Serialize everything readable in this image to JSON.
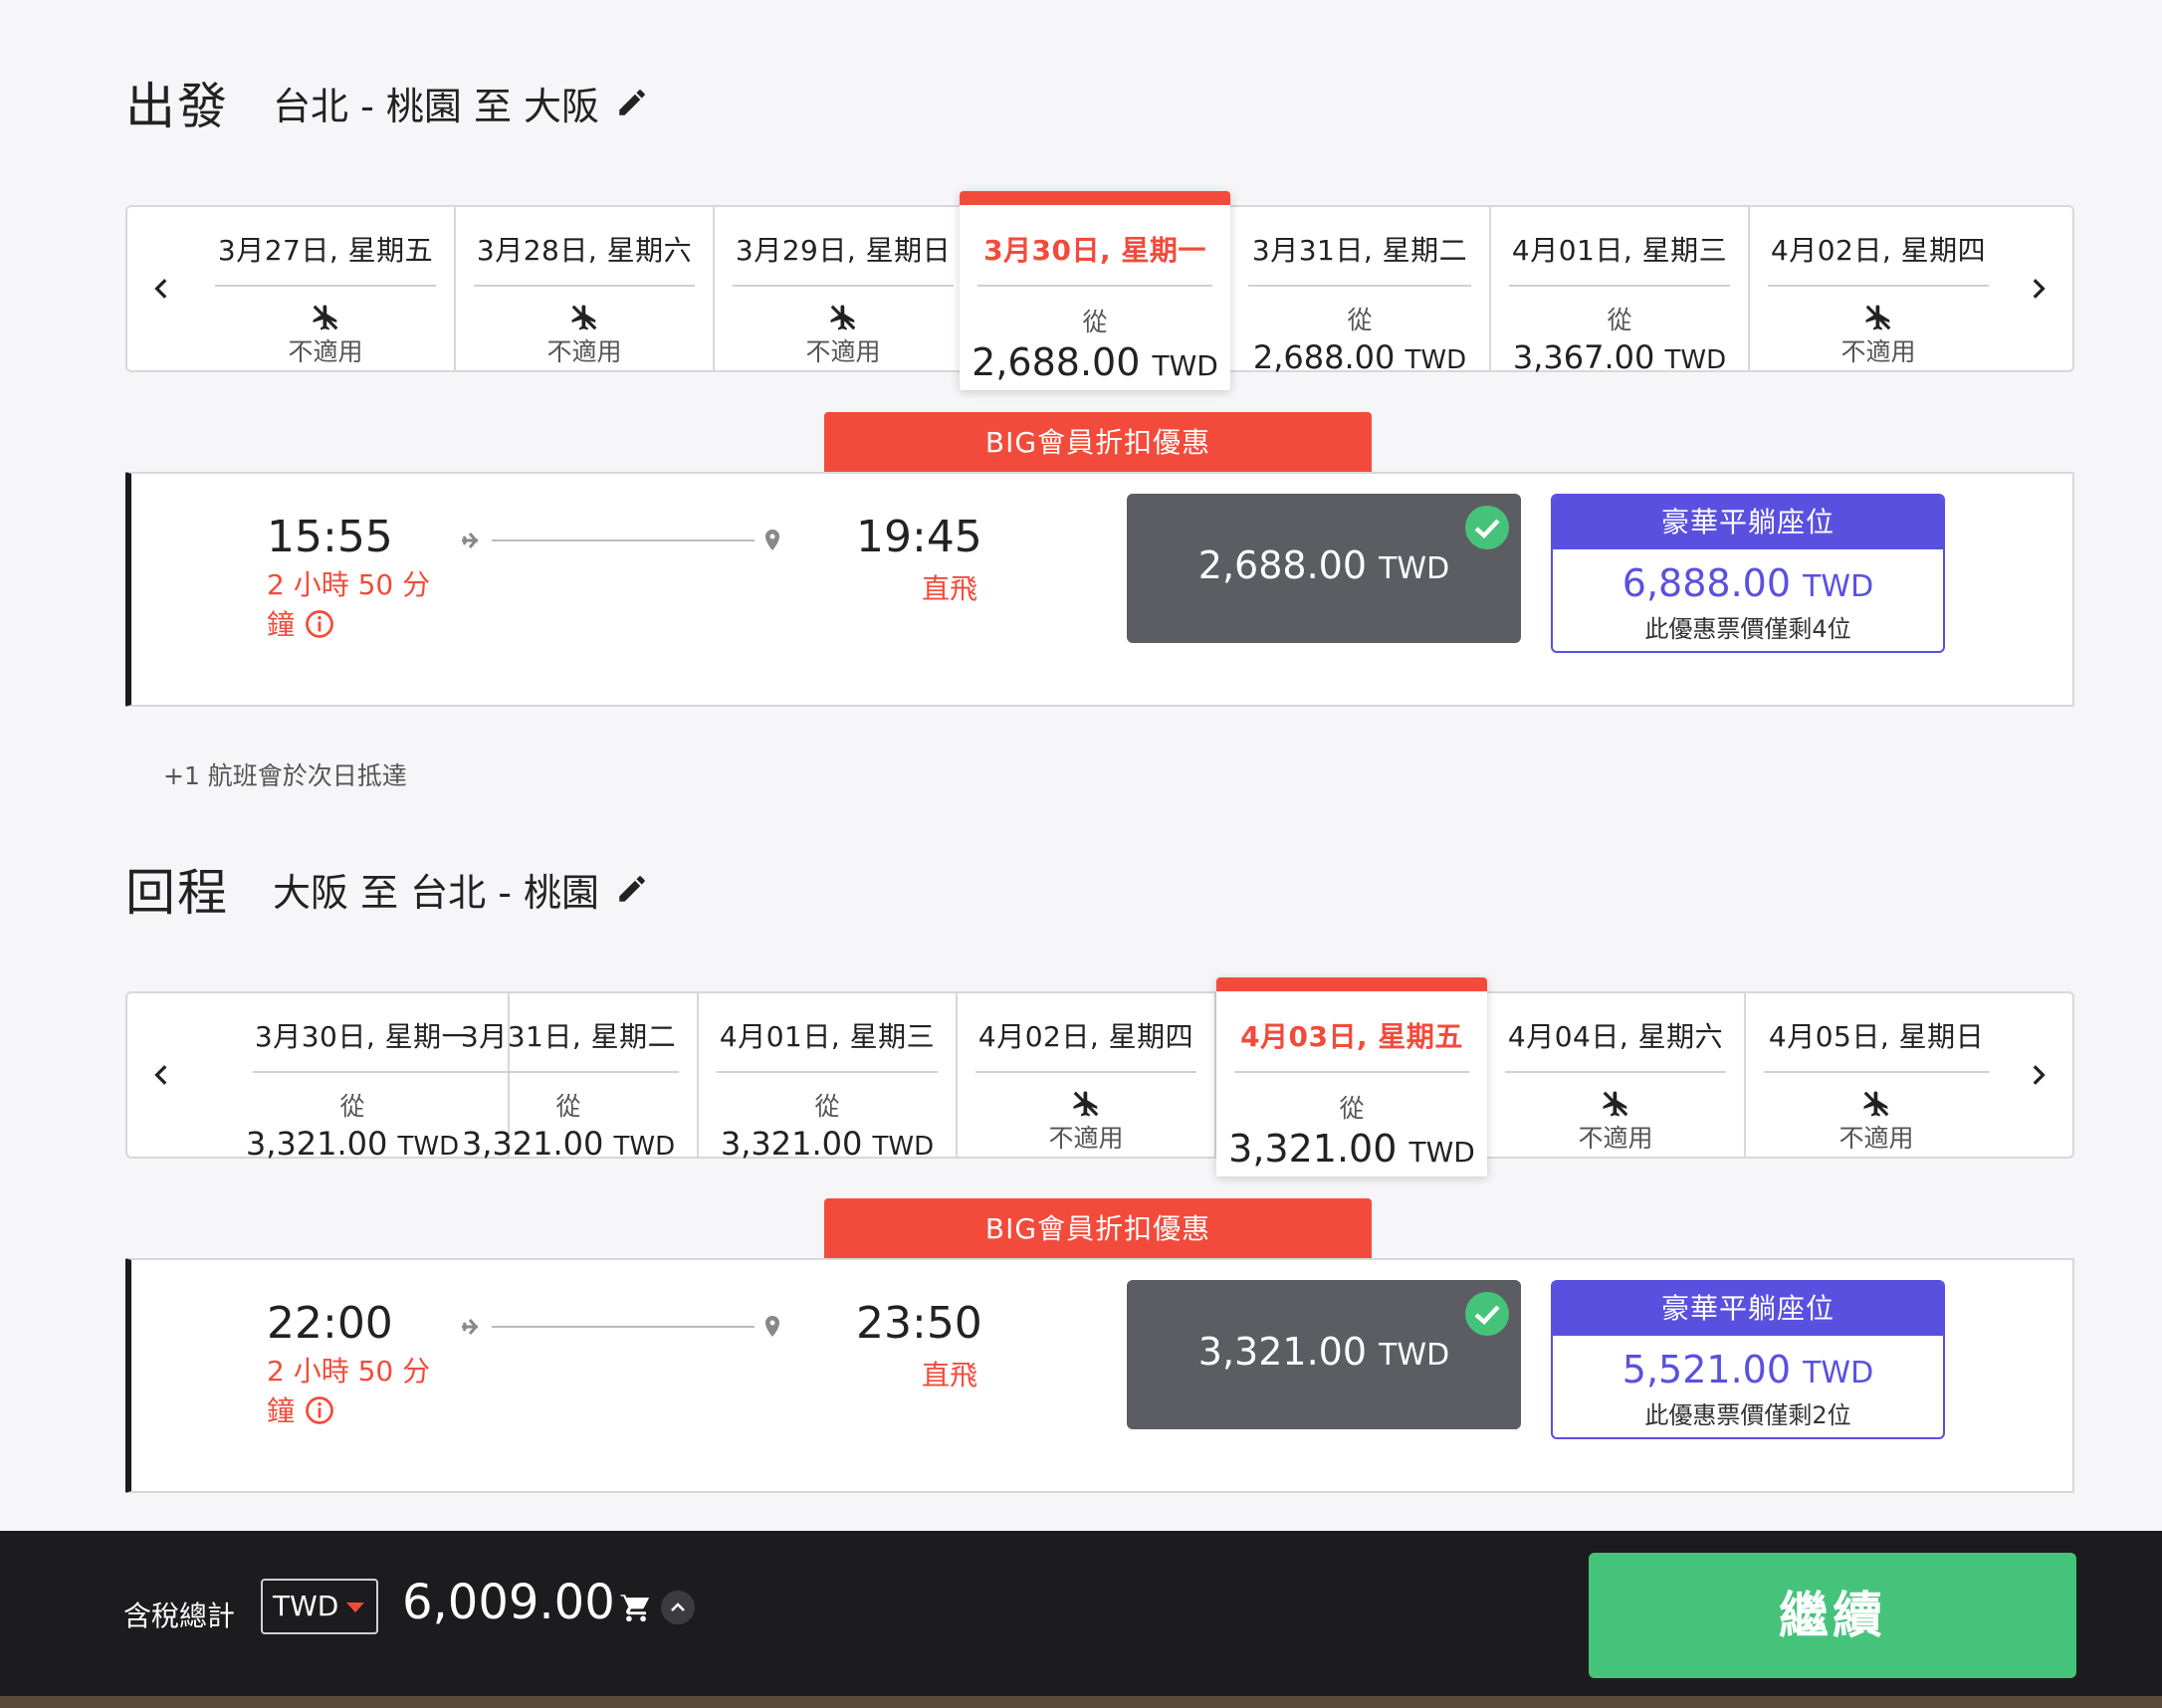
{
  "colors": {
    "accent_red": "#f24b3b",
    "flatbed_purple": "#5a50e0",
    "selected_fare_gray": "#5b5d63",
    "continue_green": "#46c37b",
    "footer_bg": "#1c1c1e"
  },
  "departure": {
    "title": "出發",
    "route": "台北 - 桃園 至 大阪",
    "dates": [
      {
        "label": "3月27日, 星期五",
        "available": false,
        "na_text": "不適用"
      },
      {
        "label": "3月28日, 星期六",
        "available": false,
        "na_text": "不適用"
      },
      {
        "label": "3月29日, 星期日",
        "available": false,
        "na_text": "不適用"
      },
      {
        "label": "3月30日, 星期一",
        "available": true,
        "from": "從",
        "price": "2,688.00",
        "currency": "TWD",
        "selected": true
      },
      {
        "label": "3月31日, 星期二",
        "available": true,
        "from": "從",
        "price": "2,688.00",
        "currency": "TWD"
      },
      {
        "label": "4月01日, 星期三",
        "available": true,
        "from": "從",
        "price": "3,367.00",
        "currency": "TWD"
      },
      {
        "label": "4月02日, 星期四",
        "available": false,
        "na_text": "不適用"
      }
    ],
    "promo": "BIG會員折扣優惠",
    "flight": {
      "depart_time": "15:55",
      "duration_line1": "2 小時 50 分",
      "duration_line2": "鐘",
      "arrive_time": "19:45",
      "stops": "直飛",
      "standard_price": "2,688.00",
      "standard_currency": "TWD",
      "flatbed_title": "豪華平躺座位",
      "flatbed_price": "6,888.00",
      "flatbed_currency": "TWD",
      "flatbed_note": "此優惠票價僅剩4位"
    },
    "next_day_note": "+1 航班會於次日抵達"
  },
  "return": {
    "title": "回程",
    "route": "大阪 至 台北 - 桃園",
    "dates": [
      {
        "label": "3月30日, 星期一",
        "available": true,
        "from": "從",
        "price": "3,321.00",
        "currency": "TWD"
      },
      {
        "label": "3月31日, 星期二",
        "available": true,
        "from": "從",
        "price": "3,321.00",
        "currency": "TWD"
      },
      {
        "label": "4月01日, 星期三",
        "available": true,
        "from": "從",
        "price": "3,321.00",
        "currency": "TWD"
      },
      {
        "label": "4月02日, 星期四",
        "available": false,
        "na_text": "不適用"
      },
      {
        "label": "4月03日, 星期五",
        "available": true,
        "from": "從",
        "price": "3,321.00",
        "currency": "TWD",
        "selected": true
      },
      {
        "label": "4月04日, 星期六",
        "available": false,
        "na_text": "不適用"
      },
      {
        "label": "4月05日, 星期日",
        "available": false,
        "na_text": "不適用"
      }
    ],
    "promo": "BIG會員折扣優惠",
    "flight": {
      "depart_time": "22:00",
      "duration_line1": "2 小時 50 分",
      "duration_line2": "鐘",
      "arrive_time": "23:50",
      "stops": "直飛",
      "standard_price": "3,321.00",
      "standard_currency": "TWD",
      "flatbed_title": "豪華平躺座位",
      "flatbed_price": "5,521.00",
      "flatbed_currency": "TWD",
      "flatbed_note": "此優惠票價僅剩2位"
    }
  },
  "footer": {
    "total_label": "含稅總計",
    "currency": "TWD",
    "total": "6,009.00",
    "continue_label": "繼續"
  }
}
